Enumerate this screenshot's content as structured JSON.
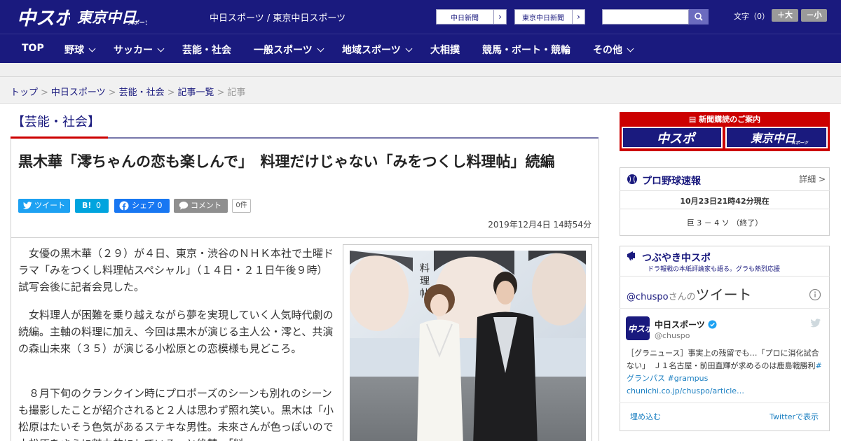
{
  "header": {
    "site_title": "中日スポーツ / 東京中日スポーツ",
    "logo_left": "中スポ",
    "logo_right": "東京中日",
    "logo_right_sub": "スポーツ",
    "paper_links": [
      "中日新聞",
      "東京中日新聞"
    ],
    "search_placeholder": "",
    "font_size_label": "文字（0）",
    "font_larger": "＋大",
    "font_smaller": "－小"
  },
  "nav": {
    "items": [
      {
        "label": "TOP",
        "dropdown": false
      },
      {
        "label": "野球",
        "dropdown": true
      },
      {
        "label": "サッカー",
        "dropdown": true
      },
      {
        "label": "芸能・社会",
        "dropdown": false
      },
      {
        "label": "一般スポーツ",
        "dropdown": true
      },
      {
        "label": "地域スポーツ",
        "dropdown": true
      },
      {
        "label": "大相撲",
        "dropdown": false
      },
      {
        "label": "競馬・ボート・競輪",
        "dropdown": false
      },
      {
        "label": "その他",
        "dropdown": true
      }
    ]
  },
  "breadcrumb": {
    "items": [
      "トップ",
      "中日スポーツ",
      "芸能・社会",
      "記事一覧"
    ],
    "current": "記事"
  },
  "article": {
    "section": "【芸能・社会】",
    "headline": "黒木華「澪ちゃんの恋も楽しんで」　料理だけじゃない「みをつくし料理帖」続編",
    "share": {
      "tweet": "ツイート",
      "hatena_icon": "B!",
      "hatena_count": "0",
      "facebook": "シェア 0",
      "comment": "コメント",
      "comment_count": "0件"
    },
    "date": "2019年12月4日 14時54分",
    "paragraphs": [
      "女優の黒木華（２９）が４日、東京・渋谷のＮＨＫ本社で土曜ドラマ「みをつくし料理帖スペシャル」（１４日・２１日午後９時）試写会後に記者会見した。",
      "女料理人が困難を乗り越えながら夢を実現していく人気時代劇の続編。主軸の料理に加え、今回は黒木が演じる主人公・澪と、共演の森山未來（３５）が演じる小松原との恋模様も見どころ。",
      "８月下旬のクランクイン時にプロポーズのシーンも別れのシーンも撮影したことが紹介されると２人は思わず照れ笑い。黒木は「小松原はたいそう色気があるステキな男性。未來さんが色っぽいので小松原をさらに魅力的にしている」と絶賛。「料"
    ]
  },
  "sidebar": {
    "subscription": {
      "title": "新聞購読のご案内",
      "logo_left": "中スポ",
      "logo_right": "東京中日",
      "logo_right_sub": "スポーツ"
    },
    "baseball": {
      "title": "プロ野球速報",
      "more": "詳細 >",
      "time": "10月23日21時42分現在",
      "score": "巨 3 － 4 ソ （終了）"
    },
    "twitter": {
      "title": "つぶやき中スポ",
      "tagline": "ドラ報戦の本紙評論家も語る。グラも熱烈応援",
      "header_handle": "@chuspo",
      "header_san": "さんの",
      "header_word": "ツイート",
      "account_name": "中日スポーツ",
      "account_handle": "@chuspo",
      "tweet_text": "［グラニュース］事実上の残留でも…「プロに消化試合ない」　Ｊ１名古屋・前田直輝が求めるのは鹿島戦勝利",
      "tweet_hashtag": "#グランパス #grampus",
      "tweet_link": "chunichi.co.jp/chuspo/article…",
      "embed": "埋め込む",
      "view_on_twitter": "Twitterで表示"
    }
  },
  "colors": {
    "brand_navy": "#1a1a7e",
    "accent_red": "#cc0000",
    "twitter_blue": "#1da1f2",
    "facebook_blue": "#1877f2"
  }
}
